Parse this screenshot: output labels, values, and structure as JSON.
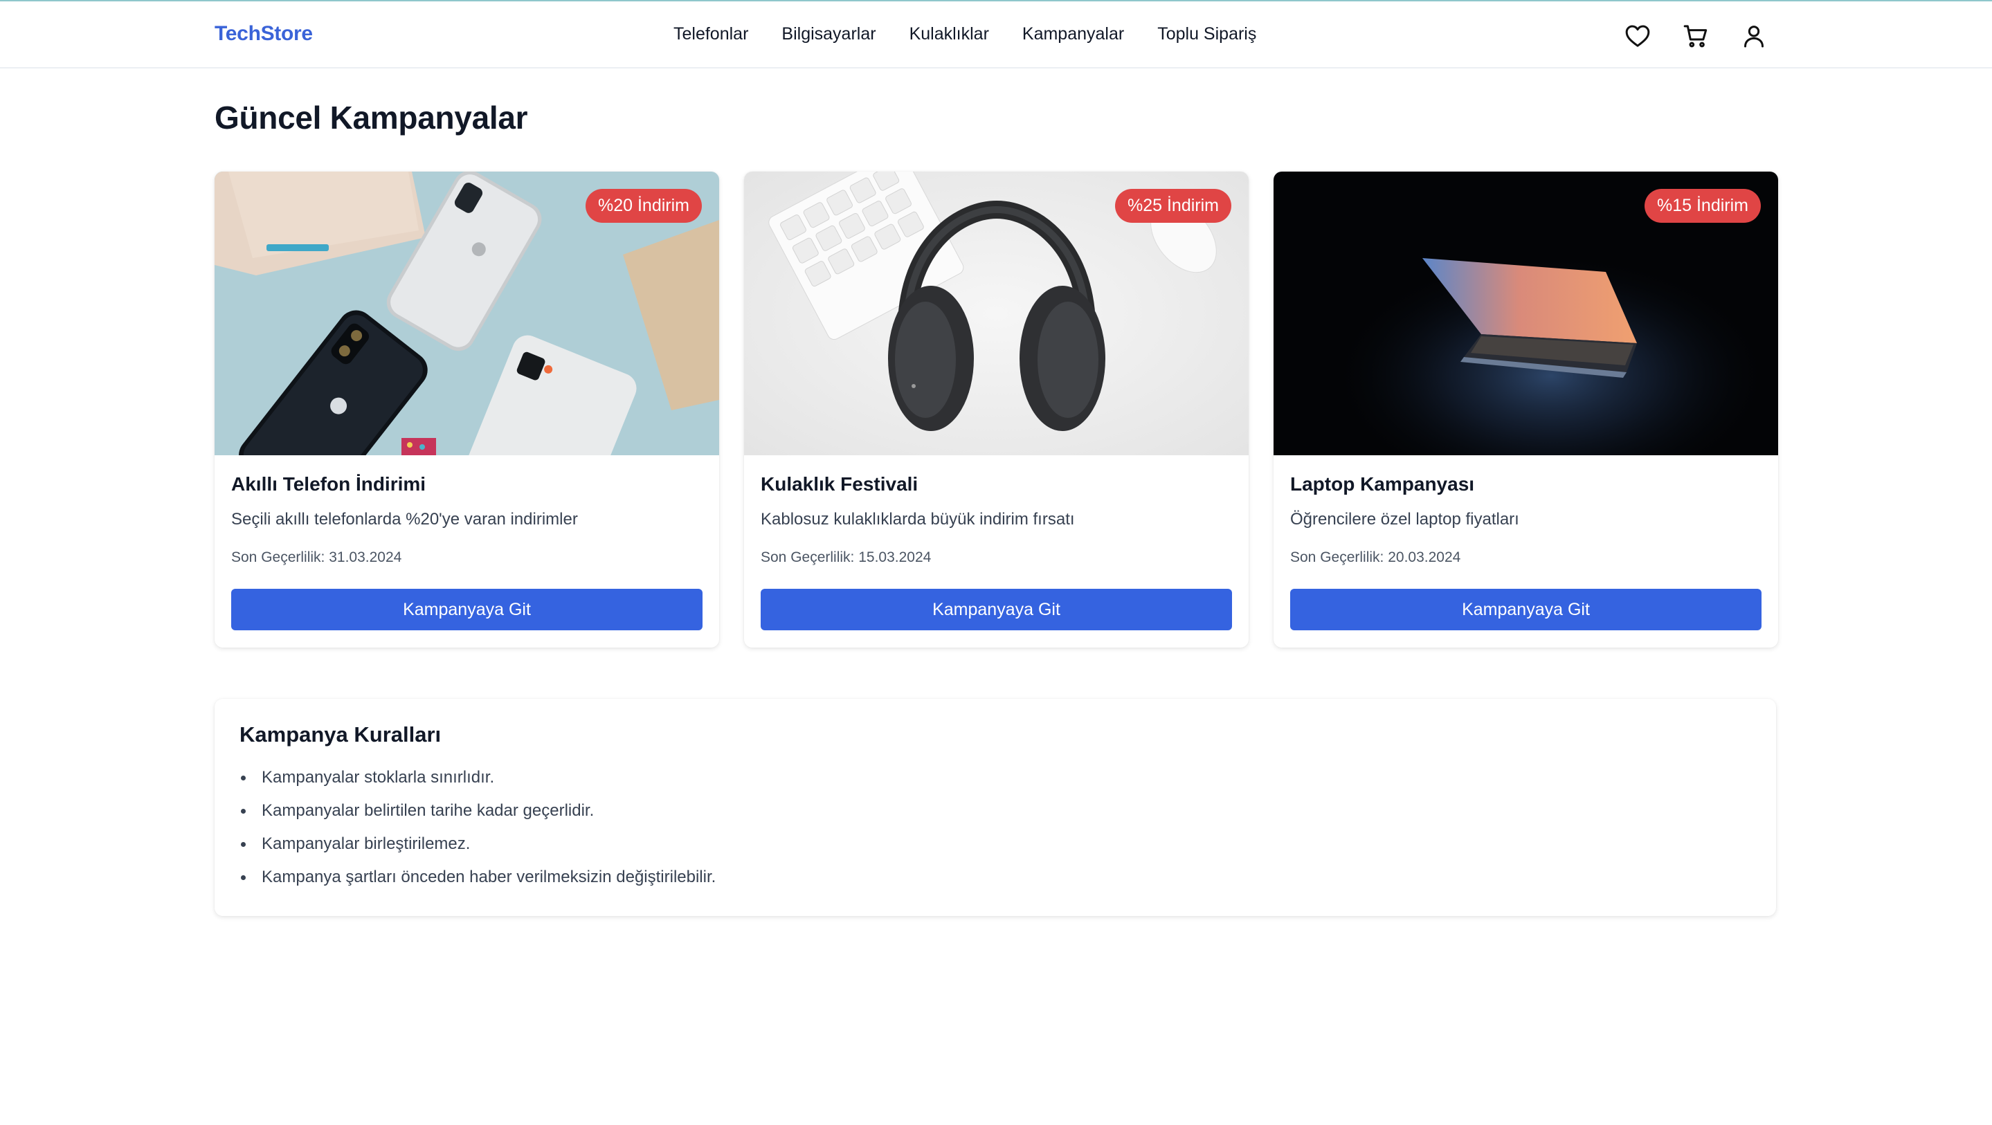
{
  "header": {
    "logo": "TechStore",
    "nav": [
      "Telefonlar",
      "Bilgisayarlar",
      "Kulaklıklar",
      "Kampanyalar",
      "Toplu Sipariş"
    ],
    "icons": [
      "heart-icon",
      "cart-icon",
      "user-icon"
    ]
  },
  "page_title": "Güncel Kampanyalar",
  "campaigns": [
    {
      "badge": "%20 İndirim",
      "title": "Akıllı Telefon İndirimi",
      "description": "Seçili akıllı telefonlarda %20'ye varan indirimler",
      "valid_until": "Son Geçerlilik: 31.03.2024",
      "button": "Kampanyaya Git"
    },
    {
      "badge": "%25 İndirim",
      "title": "Kulaklık Festivali",
      "description": "Kablosuz kulaklıklarda büyük indirim fırsatı",
      "valid_until": "Son Geçerlilik: 15.03.2024",
      "button": "Kampanyaya Git"
    },
    {
      "badge": "%15 İndirim",
      "title": "Laptop Kampanyası",
      "description": "Öğrencilere özel laptop fiyatları",
      "valid_until": "Son Geçerlilik: 20.03.2024",
      "button": "Kampanyaya Git"
    }
  ],
  "rules": {
    "title": "Kampanya Kuralları",
    "items": [
      "Kampanyalar stoklarla sınırlıdır.",
      "Kampanyalar belirtilen tarihe kadar geçerlidir.",
      "Kampanyalar birleştirilemez.",
      "Kampanya şartları önceden haber verilmeksizin değiştirilebilir."
    ]
  },
  "colors": {
    "brand": "#3a63d8",
    "button": "#3563e0",
    "badge": "#e04545"
  }
}
